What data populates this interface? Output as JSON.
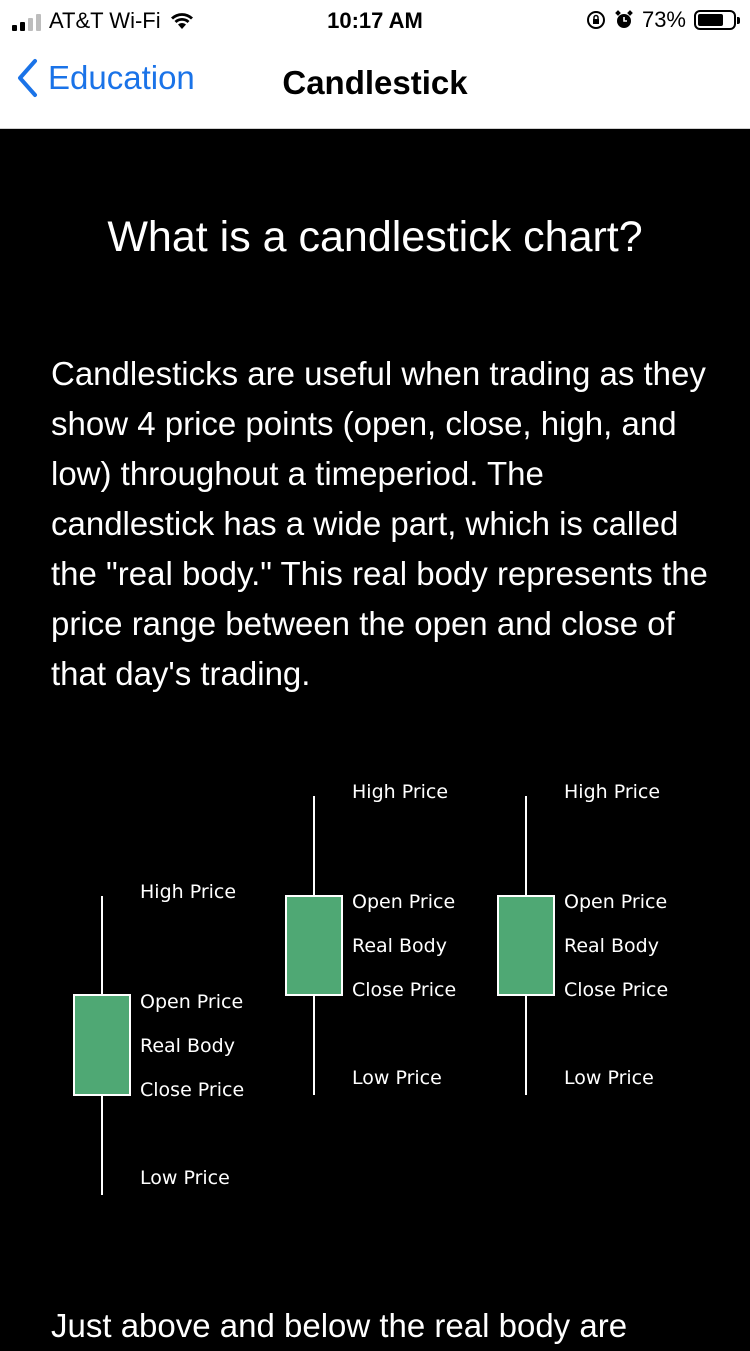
{
  "status_bar": {
    "carrier": "AT&T Wi-Fi",
    "time": "10:17 AM",
    "battery": "73%",
    "battery_level": 0.73
  },
  "nav": {
    "back_label": "Education",
    "title": "Candlestick"
  },
  "content": {
    "heading": "What is a candlestick chart?",
    "paragraph": "Candlesticks are useful when trading as they show 4 price points (open, close, high, and low) throughout a timeperiod. The candlestick has a wide part, which is called the \"real body.\" This real body represents the price range between the open and close of that day's trading.",
    "paragraph_2": "Just above and below the real body are"
  },
  "diagram": {
    "body_color": "#4fa874",
    "candles": [
      {
        "labels": {
          "high": "High Price",
          "open": "Open Price",
          "body": "Real Body",
          "close": "Close Price",
          "low": "Low Price"
        }
      },
      {
        "labels": {
          "high": "High Price",
          "open": "Open Price",
          "body": "Real Body",
          "close": "Close Price",
          "low": "Low Price"
        }
      },
      {
        "labels": {
          "high": "High Price",
          "open": "Open Price",
          "body": "Real Body",
          "close": "Close Price",
          "low": "Low Price"
        }
      }
    ]
  }
}
